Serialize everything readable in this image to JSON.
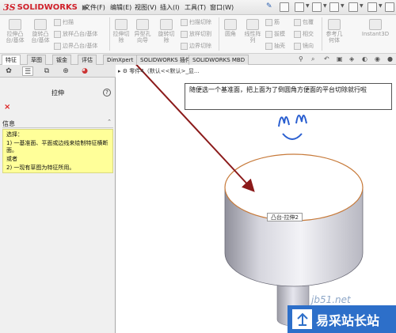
{
  "app": {
    "logo_prefix": "3S",
    "logo_text": "SOLIDWORKS",
    "logo_arrow": "▶"
  },
  "menu": [
    "文件(F)",
    "编辑(E)",
    "视图(V)",
    "插入(I)",
    "工具(T)",
    "窗口(W)"
  ],
  "ribbon": {
    "large_buttons": [
      {
        "label": "拉伸凸\n台/基体"
      },
      {
        "label": "旋转凸\n台/基体"
      },
      {
        "label": "拉伸切\n除"
      },
      {
        "label": "异型孔\n向导"
      },
      {
        "label": "旋转切\n除"
      },
      {
        "label": "圆角"
      },
      {
        "label": "线性阵\n列"
      },
      {
        "label": "参考几\n何体"
      },
      {
        "label": "Instant3D"
      }
    ],
    "small_buttons": [
      {
        "label": "扫描"
      },
      {
        "label": "放样凸台/基体"
      },
      {
        "label": "边界凸台/基体"
      },
      {
        "label": "扫描切除"
      },
      {
        "label": "放样切割"
      },
      {
        "label": "边界切除"
      },
      {
        "label": "筋"
      },
      {
        "label": "拔模"
      },
      {
        "label": "抽壳"
      },
      {
        "label": "包覆"
      },
      {
        "label": "相交"
      },
      {
        "label": "镜向"
      }
    ]
  },
  "tabs": [
    "特征",
    "草图",
    "钣金",
    "评估",
    "DimXpert",
    "SOLIDWORKS 插件",
    "SOLIDWORKS MBD"
  ],
  "active_tab": "特征",
  "property_manager": {
    "title": "拉伸",
    "help": "?",
    "close": "×",
    "info_header": "信息",
    "info_lines": [
      "选择：",
      "1) 一基准面、平面或边线来绘制特征横断面。",
      "或者",
      "2) 一现有草图为特征所用。"
    ]
  },
  "viewport": {
    "tree_text": "零件4（默认<<默认>_显...",
    "tooltip": "随便选一个基准面，把上面为了倒圆角方便面的平台切除就行啦",
    "feature_label": "凸台-拉伸2",
    "annotation_color": "#8b1a1a",
    "smiley_color": "#2a5fd0"
  },
  "watermark": {
    "text": "易采站长站",
    "url": "jb51.net"
  }
}
